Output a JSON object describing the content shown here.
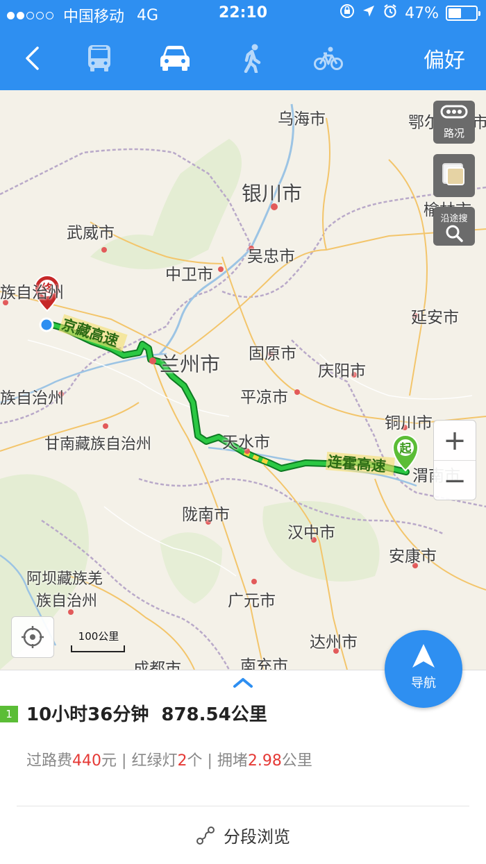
{
  "status_bar": {
    "carrier": "中国移动",
    "network": "4G",
    "time": "22:10",
    "battery": "47%",
    "battery_level": 0.47,
    "signal_bars": 2
  },
  "nav": {
    "back_icon": "chevron-left-icon",
    "modes": [
      "bus-icon",
      "car-icon",
      "walk-icon",
      "bike-icon"
    ],
    "active_mode": "car",
    "preferences_label": "偏好"
  },
  "map": {
    "traffic_label": "路况",
    "along_search_label": "沿途搜",
    "zoom_in": "+",
    "zoom_out": "−",
    "scale_label": "100公里",
    "start_marker": "起",
    "end_marker": "终",
    "road_labels": [
      "京藏高速",
      "连霍高速"
    ],
    "cities": [
      "乌海市",
      "鄂尔多斯市",
      "银川市",
      "榆林市",
      "武威市",
      "吴忠市",
      "中卫市",
      "族自治州",
      "延安市",
      "固原市",
      "兰州市",
      "庆阳市",
      "族自治州",
      "平凉市",
      "铜川市",
      "甘南藏族自治州",
      "天水市",
      "渭南市",
      "陇南市",
      "汉中市",
      "安康市",
      "阿坝藏族羌",
      "族自治州",
      "广元市",
      "达州市",
      "成都市",
      "南充市"
    ]
  },
  "panel": {
    "route_index": "1",
    "duration": "10小时36分钟",
    "distance": "878.54公里",
    "toll_label": "过路费",
    "toll_value": "440",
    "toll_unit": "元",
    "lights_label": "红绿灯",
    "lights_value": "2",
    "lights_unit": "个",
    "jam_label": "拥堵",
    "jam_value": "2.98",
    "jam_unit": "公里",
    "separator": "|",
    "segment_browse": "分段浏览",
    "navigate_label": "导航"
  },
  "colors": {
    "brand_blue": "#2e8ff1",
    "route_green": "#1fb53b",
    "alert_red": "#e53935",
    "start_green": "#5bbd36",
    "end_red": "#c62828"
  }
}
